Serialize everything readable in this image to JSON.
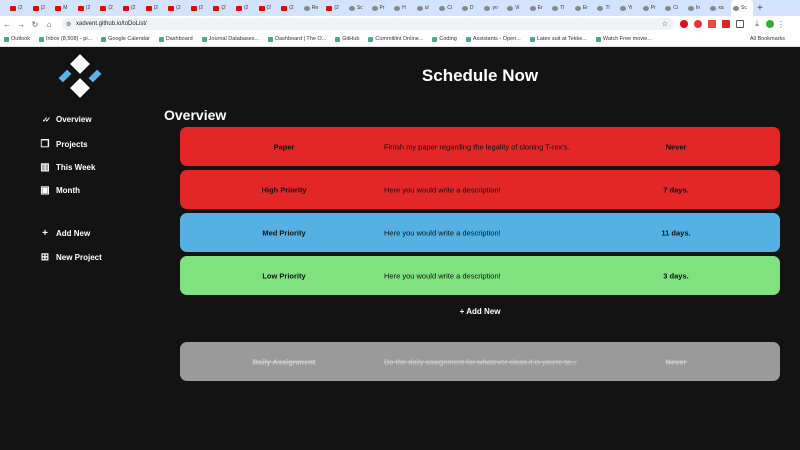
{
  "browser": {
    "tabs": [
      "(2",
      "(2",
      "M",
      "(2",
      "(2",
      "(2",
      "(2",
      "(2",
      "(2",
      "(2",
      "(2",
      "(2",
      "(2",
      "Re",
      "(2",
      "Sc",
      "Pr",
      "H",
      "ul",
      "Ci",
      "D",
      "yo",
      "Vi",
      "Er",
      "Tl",
      "Er",
      "Tl",
      "Yi",
      "Pr",
      "Ci",
      "In",
      "xa",
      "Sc"
    ],
    "url": "xadvent.github.io/toDoList/",
    "bookmarks": [
      "Outlook",
      "Inbox (8,508) - pi...",
      "Google Calendar",
      "Dashboard",
      "Journal Databases...",
      "Dashboard | The O...",
      "GitHub",
      "Commitlint Online...",
      "Coding",
      "Assistants - Open...",
      "Latex suit at Tekke...",
      "Watch Free movie..."
    ],
    "all_bookmarks": "All Bookmarks"
  },
  "header": {
    "title": "Schedule Now"
  },
  "sidebar": {
    "items": [
      {
        "label": "Overview",
        "icon": "double-check-icon"
      },
      {
        "label": "Projects",
        "icon": "documents-icon"
      },
      {
        "label": "This Week",
        "icon": "columns-icon"
      },
      {
        "label": "Month",
        "icon": "calendar-icon"
      },
      {
        "label": "Add New",
        "icon": "plus-icon"
      },
      {
        "label": "New Project",
        "icon": "add-box-icon"
      }
    ]
  },
  "main": {
    "heading": "Overview",
    "tasks": [
      {
        "name": "Paper",
        "description": "Finish my paper regarding the legality of cloning T-rex's.",
        "due": "Never",
        "color": "#e32727"
      },
      {
        "name": "High Priority",
        "description": "Here you would write a description!",
        "due": "7 days.",
        "color": "#e32727"
      },
      {
        "name": "Med Priority",
        "description": "Here you would write a description!",
        "due": "11 days.",
        "color": "#55b0e3"
      },
      {
        "name": "Low Priority",
        "description": "Here you would write a description!",
        "due": "3 days.",
        "color": "#7fe27f"
      }
    ],
    "add_new": "Add New",
    "completed": [
      {
        "name": "Daily Assignment",
        "description": "Do the daily assignment for whatever class it is you're ta...",
        "due": "Never",
        "color": "#9a9a9a"
      }
    ]
  }
}
